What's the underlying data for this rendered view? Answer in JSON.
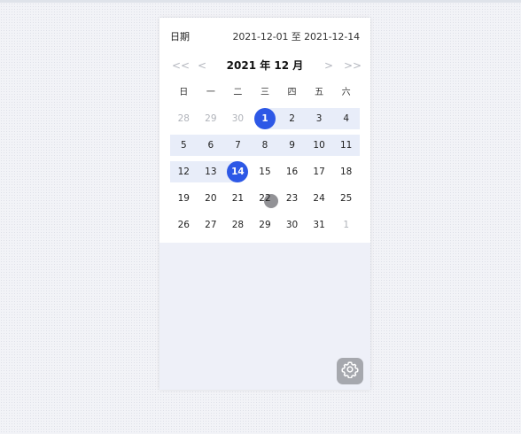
{
  "header": {
    "label": "日期",
    "range_text": "2021-12-01 至 2021-12-14"
  },
  "nav": {
    "prev_year": "<<",
    "prev_month": "<",
    "title": "2021 年 12 月",
    "next_month": ">",
    "next_year": ">>"
  },
  "weekdays": [
    "日",
    "一",
    "二",
    "三",
    "四",
    "五",
    "六"
  ],
  "weeks": [
    [
      "28",
      "29",
      "30",
      "1",
      "2",
      "3",
      "4"
    ],
    [
      "5",
      "6",
      "7",
      "8",
      "9",
      "10",
      "11"
    ],
    [
      "12",
      "13",
      "14",
      "15",
      "16",
      "17",
      "18"
    ],
    [
      "19",
      "20",
      "21",
      "22",
      "23",
      "24",
      "25"
    ],
    [
      "26",
      "27",
      "28",
      "29",
      "30",
      "31",
      "1"
    ]
  ],
  "selection": {
    "start": "2021-12-01",
    "end": "2021-12-14"
  },
  "colors": {
    "accent": "#2d58e6",
    "range_bg": "#e8edf9"
  },
  "icons": {
    "settings": "gear-icon"
  }
}
